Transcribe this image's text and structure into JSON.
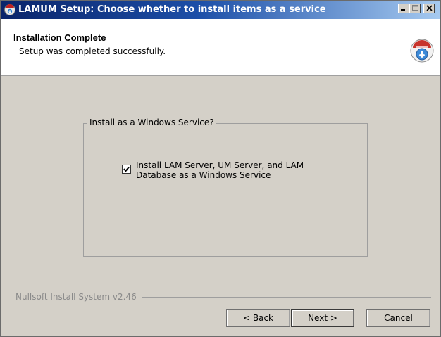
{
  "window": {
    "title": "LAMUM Setup: Choose whether to install items as a service",
    "controls": {
      "minimize": "_",
      "maximize": "□",
      "close": "X"
    }
  },
  "header": {
    "title": "Installation Complete",
    "subtitle": "Setup was completed successfully.",
    "logo_icon": "installer-disk-icon"
  },
  "group": {
    "legend": "Install as a Windows Service?",
    "checkbox": {
      "checked": true,
      "label": "Install LAM Server, UM Server, and LAM Database as a Windows Service"
    }
  },
  "footer": {
    "brand": "Nullsoft Install System v2.46",
    "back_label": "< Back",
    "next_label": "Next >",
    "cancel_label": "Cancel"
  },
  "colors": {
    "titlebar_start": "#0a246a",
    "titlebar_end": "#a6caf0",
    "dialog_bg": "#d4d0c8"
  }
}
